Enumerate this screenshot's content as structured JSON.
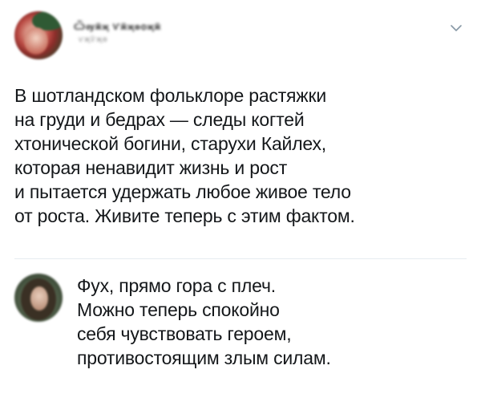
{
  "post": {
    "author_name": "Ѽѹӂҗ Ѵӂҗѳѻҗӂ",
    "author_handle": "ѵҗѷҗѳ",
    "menu_icon": "chevron-down-icon",
    "text_lines": [
      "В шотландском фольклоре растяжки",
      "на груди и бедрах — следы когтей",
      "хтонической богини, старухи Кайлех,",
      "которая ненавидит жизнь и рост",
      "и пытается удержать любое живое тело",
      "от роста. Живите теперь с этим фактом."
    ]
  },
  "reply": {
    "text_lines": [
      "Фух, прямо гора с плеч.",
      "Можно теперь спокойно",
      "себя чувствовать героем,",
      "противостоящим злым силам."
    ]
  },
  "colors": {
    "text": "#14171a",
    "divider": "#e6ecf0",
    "chevron": "#8899a6"
  }
}
